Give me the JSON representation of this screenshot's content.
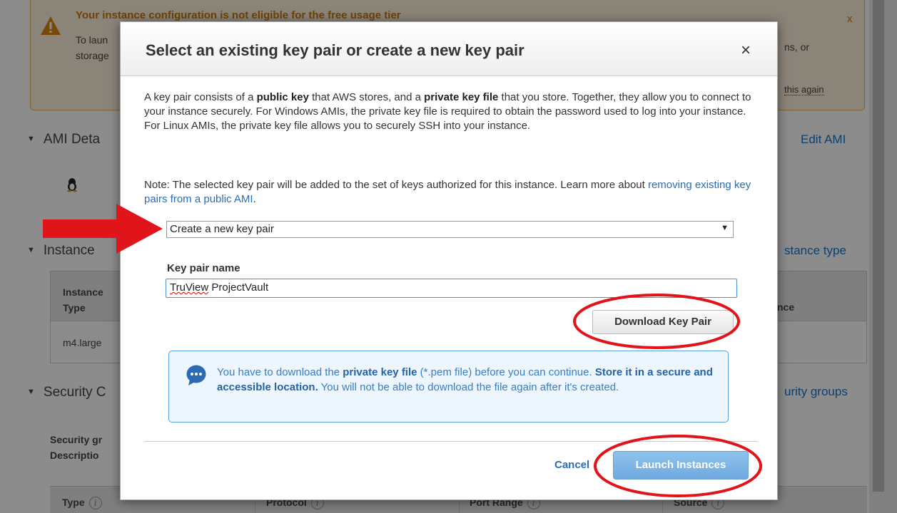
{
  "background": {
    "warning": {
      "title": "Your instance configuration is not eligible for the free usage tier",
      "line1": "To laun",
      "line2": "storage",
      "right_text": "ns, or",
      "right_link": "this again",
      "close": "x"
    },
    "sections": {
      "ami": "AMI Deta",
      "ami_link": "Edit AMI",
      "instance": "Instance",
      "instance_link": "stance type",
      "security": "Security C",
      "security_link": "urity groups"
    },
    "instance_table": {
      "header1": "Instance",
      "header2": "Type",
      "header_right": "nce",
      "row1": "m4.large"
    },
    "security_label1": "Security gr",
    "security_label2": "Descriptio",
    "footer_columns": [
      "Type",
      "Protocol",
      "Port Range",
      "Source"
    ],
    "info_glyph": "i"
  },
  "modal": {
    "title": "Select an existing key pair or create a new key pair",
    "close": "×",
    "para1": {
      "t1": "A key pair consists of a ",
      "b1": "public key",
      "t2": " that AWS stores, and a ",
      "b2": "private key file",
      "t3": " that you store. Together, they allow you to connect to your instance securely. For Windows AMIs, the private key file is required to obtain the password used to log into your instance. For Linux AMIs, the private key file allows you to securely SSH into your instance."
    },
    "para2": {
      "t1": "Note: The selected key pair will be added to the set of keys authorized for this instance. Learn more about ",
      "link": "removing existing key pairs from a public AMI",
      "t2": "."
    },
    "select_value": "Create a new key pair",
    "select_arrow": "▼",
    "key_label": "Key pair name",
    "key_value_a": "TruView",
    "key_value_b": " ProjectVault",
    "download_button": "Download Key Pair",
    "info": {
      "t1": "You have to download the ",
      "b1": "private key file",
      "t2": " (*.pem file) before you can continue. ",
      "b2": "Store it in a secure and accessible location.",
      "t3": " You will not be able to download the file again after it's created."
    },
    "cancel": "Cancel",
    "launch": "Launch Instances"
  },
  "colors": {
    "annotation_red": "#e0141a",
    "link_blue": "#2a6db5",
    "info_blue": "#3a7dc6",
    "launch_blue": "#7fb6e6"
  },
  "icons": {
    "warning": "warning-triangle-icon",
    "linux": "linux-penguin-icon",
    "chat": "chat-bubble-icon",
    "arrow": "red-arrow-annotation"
  }
}
